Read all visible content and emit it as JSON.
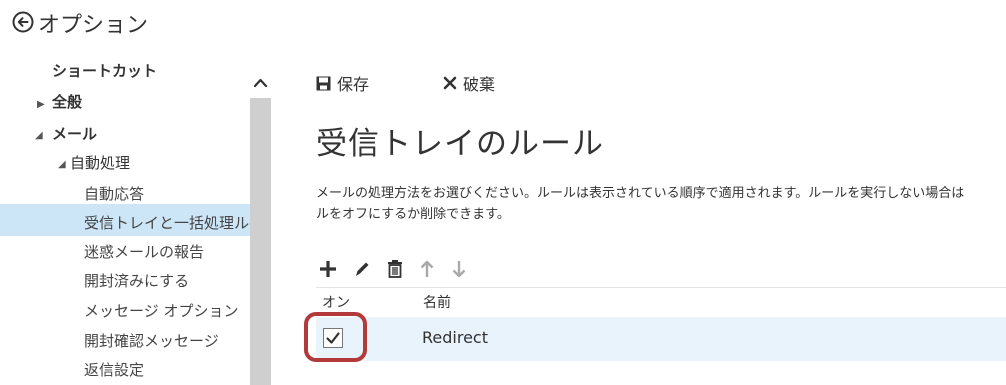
{
  "header": {
    "title": "オプション"
  },
  "sidebar": {
    "shortcuts": "ショートカット",
    "general": "全般",
    "mail": "メール",
    "auto_processing": "自動処理",
    "items": [
      {
        "label": "自動応答",
        "selected": false
      },
      {
        "label": "受信トレイと一括処理ル-",
        "selected": true
      },
      {
        "label": "迷惑メールの報告",
        "selected": false
      },
      {
        "label": "開封済みにする",
        "selected": false
      },
      {
        "label": "メッセージ オプション",
        "selected": false
      },
      {
        "label": "開封確認メッセージ",
        "selected": false
      },
      {
        "label": "返信設定",
        "selected": false
      }
    ],
    "selected_color": "#cde6f7"
  },
  "toolbar": {
    "save_label": "保存",
    "discard_label": "破棄"
  },
  "main": {
    "title": "受信トレイのルール",
    "description_line1": "メールの処理方法をお選びください。ルールは表示されている順序で適用されます。ルールを実行しない場合は",
    "description_line2": "ルをオフにするか削除できます。"
  },
  "rule_tools": [
    "plus-icon",
    "pencil-icon",
    "trash-icon",
    "arrow-up-icon",
    "arrow-down-icon"
  ],
  "table": {
    "col_on": "オン",
    "col_name": "名前",
    "rows": [
      {
        "on": true,
        "name": "Redirect"
      }
    ]
  },
  "colors": {
    "row_highlight": "#e8f3fb",
    "annotation_border": "#b33a3a"
  }
}
